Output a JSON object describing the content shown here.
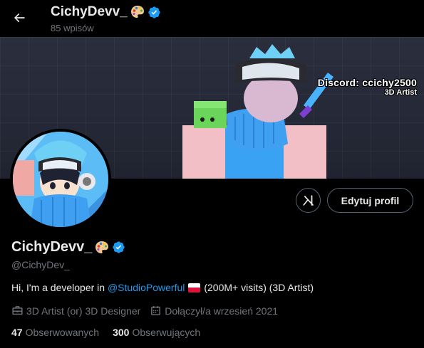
{
  "header": {
    "name": "CichyDevv_",
    "posts": "85 wpisów"
  },
  "banner": {
    "discord": "Discord: ccichy2500",
    "role": "3D Artist"
  },
  "actions": {
    "edit_profile": "Edytuj profil",
    "xai_logo_text": "xl"
  },
  "profile": {
    "name": "CichyDevv_",
    "handle": "@CichyDev_",
    "bio": {
      "prefix": "Hi, I'm a developer in ",
      "mention": "@StudioPowerful",
      "suffix": "(200M+ visits) (3D Artist)"
    },
    "job": "3D Artist (or) 3D Designer",
    "joined": "Dołączył/a wrzesień 2021",
    "following_count": "47",
    "following_label": "Obserwowanych",
    "followers_count": "300",
    "followers_label": "Obserwujących"
  },
  "colors": {
    "accent": "#1d9bf0",
    "muted": "#71767b",
    "text": "#e7e9ea",
    "background": "#000000"
  },
  "icons": [
    "back-arrow-icon",
    "palette-emoji-icon",
    "verified-badge-icon",
    "xai-icon",
    "briefcase-icon",
    "calendar-icon",
    "poland-flag-icon"
  ]
}
